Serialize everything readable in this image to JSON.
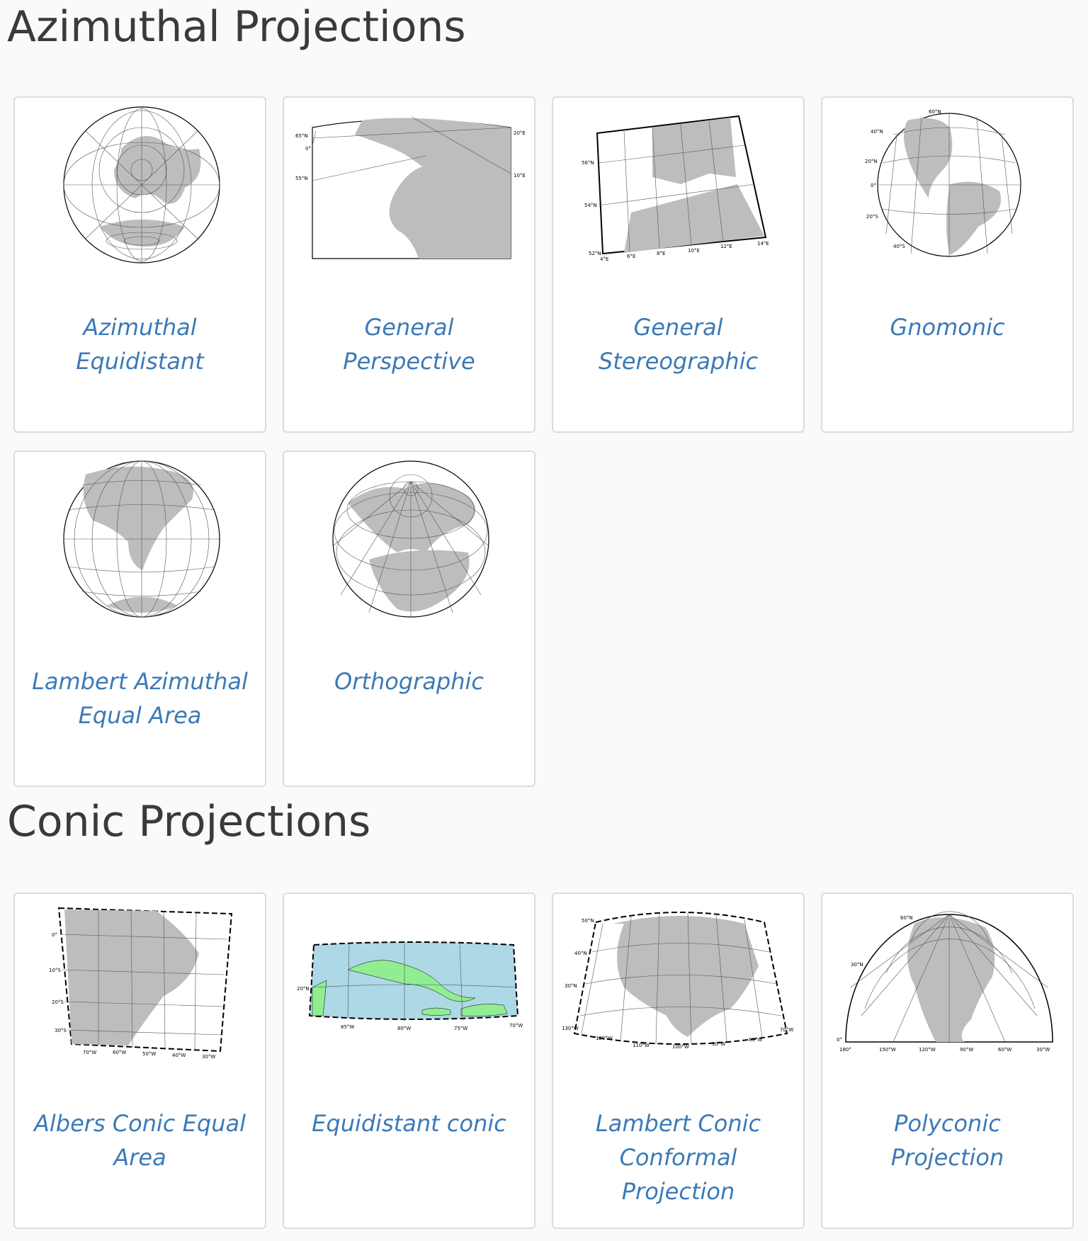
{
  "sections": {
    "azimuthal": {
      "title": "Azimuthal Projections",
      "cards": [
        {
          "label": "Azimuthal Equidistant"
        },
        {
          "label": "General Perspective",
          "ticks": [
            "65°N",
            "55°N",
            "0°",
            "20°E",
            "10°E"
          ]
        },
        {
          "label": "General Stereographic",
          "ticks": [
            "56°N",
            "54°N",
            "52°N",
            "4°E",
            "6°E",
            "8°E",
            "10°E",
            "12°E",
            "14°E"
          ]
        },
        {
          "label": "Gnomonic",
          "ticks": [
            "60°N",
            "40°N",
            "20°N",
            "0°",
            "20°S",
            "40°S"
          ]
        },
        {
          "label": "Lambert Azimuthal Equal Area"
        },
        {
          "label": "Orthographic"
        }
      ]
    },
    "conic": {
      "title": "Conic Projections",
      "cards": [
        {
          "label": "Albers Conic Equal Area",
          "ticks": [
            "0°",
            "10°S",
            "20°S",
            "30°S",
            "70°W",
            "60°W",
            "50°W",
            "40°W",
            "30°W"
          ]
        },
        {
          "label": "Equidistant conic",
          "ticks": [
            "20°N",
            "85°W",
            "80°W",
            "75°W",
            "70°W"
          ]
        },
        {
          "label": "Lambert Conic Conformal Projection",
          "ticks": [
            "50°N",
            "40°N",
            "30°N",
            "130°W",
            "120°W",
            "110°W",
            "100°W",
            "90°W",
            "80°W",
            "70°W"
          ]
        },
        {
          "label": "Polyconic Projection",
          "ticks": [
            "60°N",
            "30°N",
            "0°",
            "180°",
            "150°W",
            "120°W",
            "90°W",
            "60°W",
            "30°W"
          ]
        }
      ]
    }
  },
  "colors": {
    "link": "#3b7ab7",
    "land": "#bdbdbd",
    "ocean": "#add8e6",
    "green_land": "#90ee90"
  }
}
